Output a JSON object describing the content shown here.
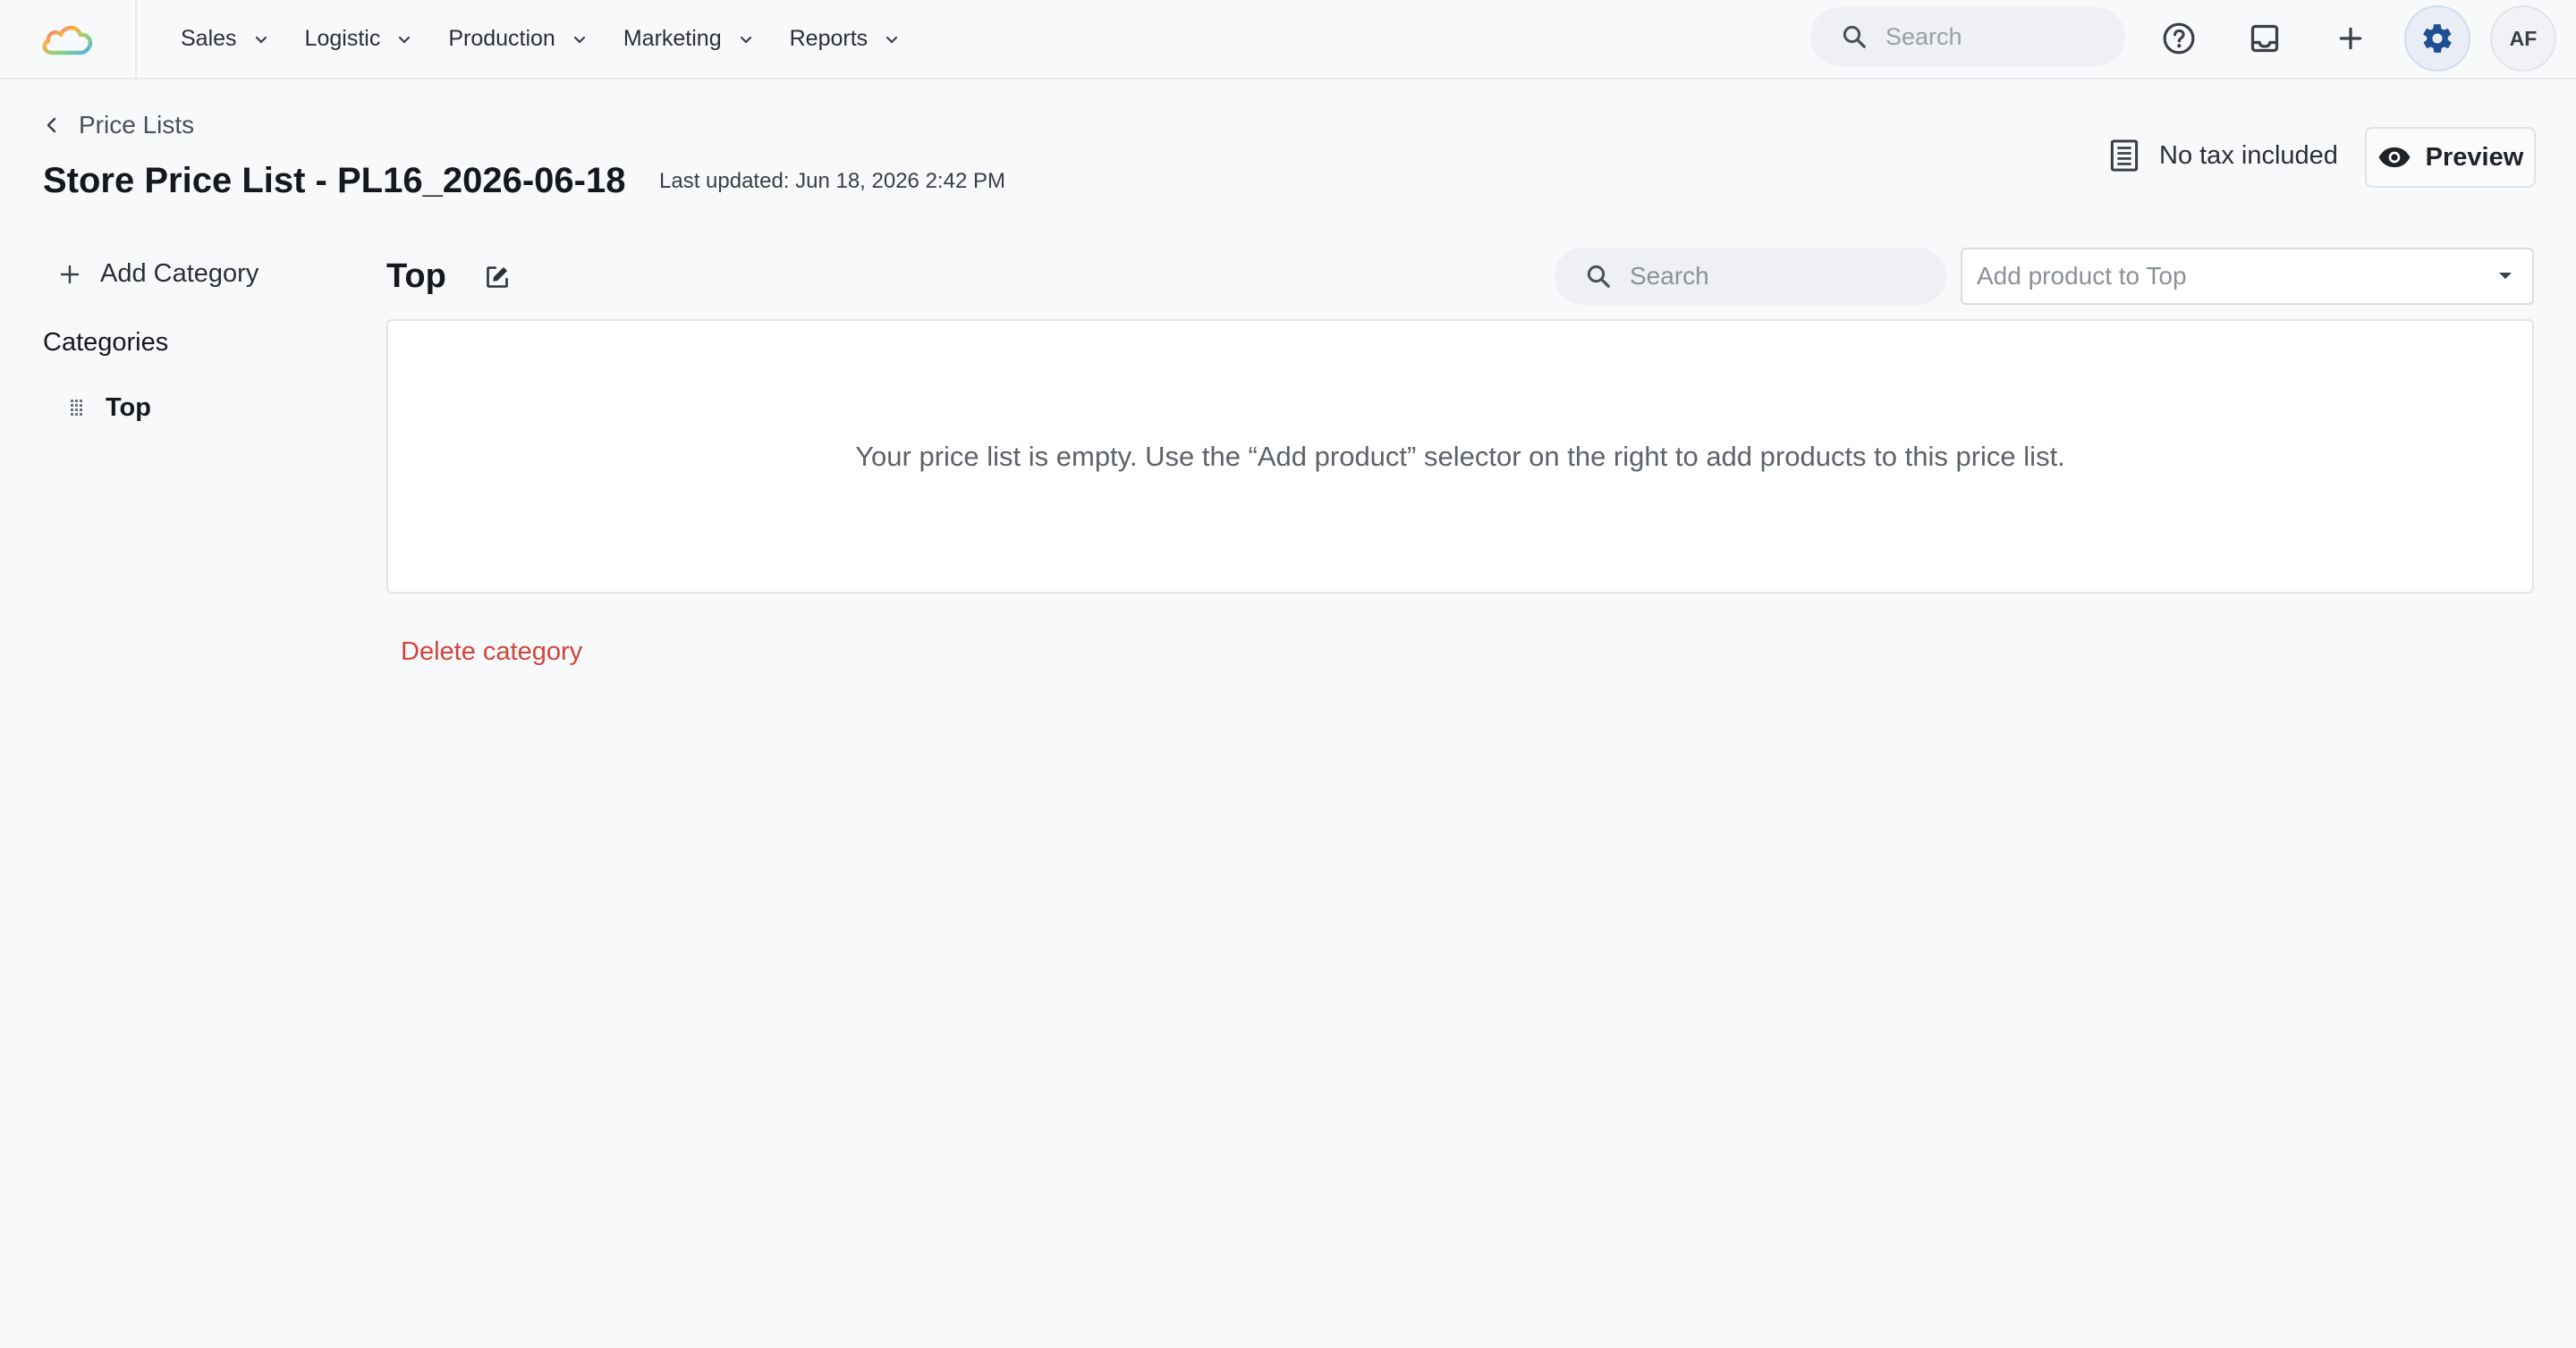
{
  "nav": {
    "items": [
      {
        "label": "Sales"
      },
      {
        "label": "Logistic"
      },
      {
        "label": "Production"
      },
      {
        "label": "Marketing"
      },
      {
        "label": "Reports"
      }
    ],
    "search_placeholder": "Search",
    "avatar_initials": "AF"
  },
  "header": {
    "back_label": "Price Lists",
    "title": "Store Price List - PL16_2026-06-18",
    "last_updated": "Last updated: Jun 18, 2026 2:42 PM",
    "tax_label": "No tax included",
    "preview_label": "Preview"
  },
  "sidebar": {
    "add_category_label": "Add Category",
    "categories_heading": "Categories",
    "categories": [
      {
        "label": "Top"
      }
    ]
  },
  "main": {
    "category_title": "Top",
    "search_placeholder": "Search",
    "add_product_placeholder": "Add product to Top",
    "empty_message": "Your price list is empty. Use the “Add product” selector on the right to add products to this price list.",
    "delete_label": "Delete category"
  },
  "colors": {
    "background": "#f8f9fb",
    "accent": "#1d4f91",
    "danger": "#d4433b"
  },
  "icons": [
    "cloud-logo-icon",
    "chevron-down-icon",
    "search-icon",
    "help-icon",
    "inbox-icon",
    "plus-icon",
    "gear-icon",
    "chevron-left-icon",
    "receipt-icon",
    "eye-icon",
    "drag-handle-icon",
    "edit-icon",
    "caret-down-icon"
  ]
}
